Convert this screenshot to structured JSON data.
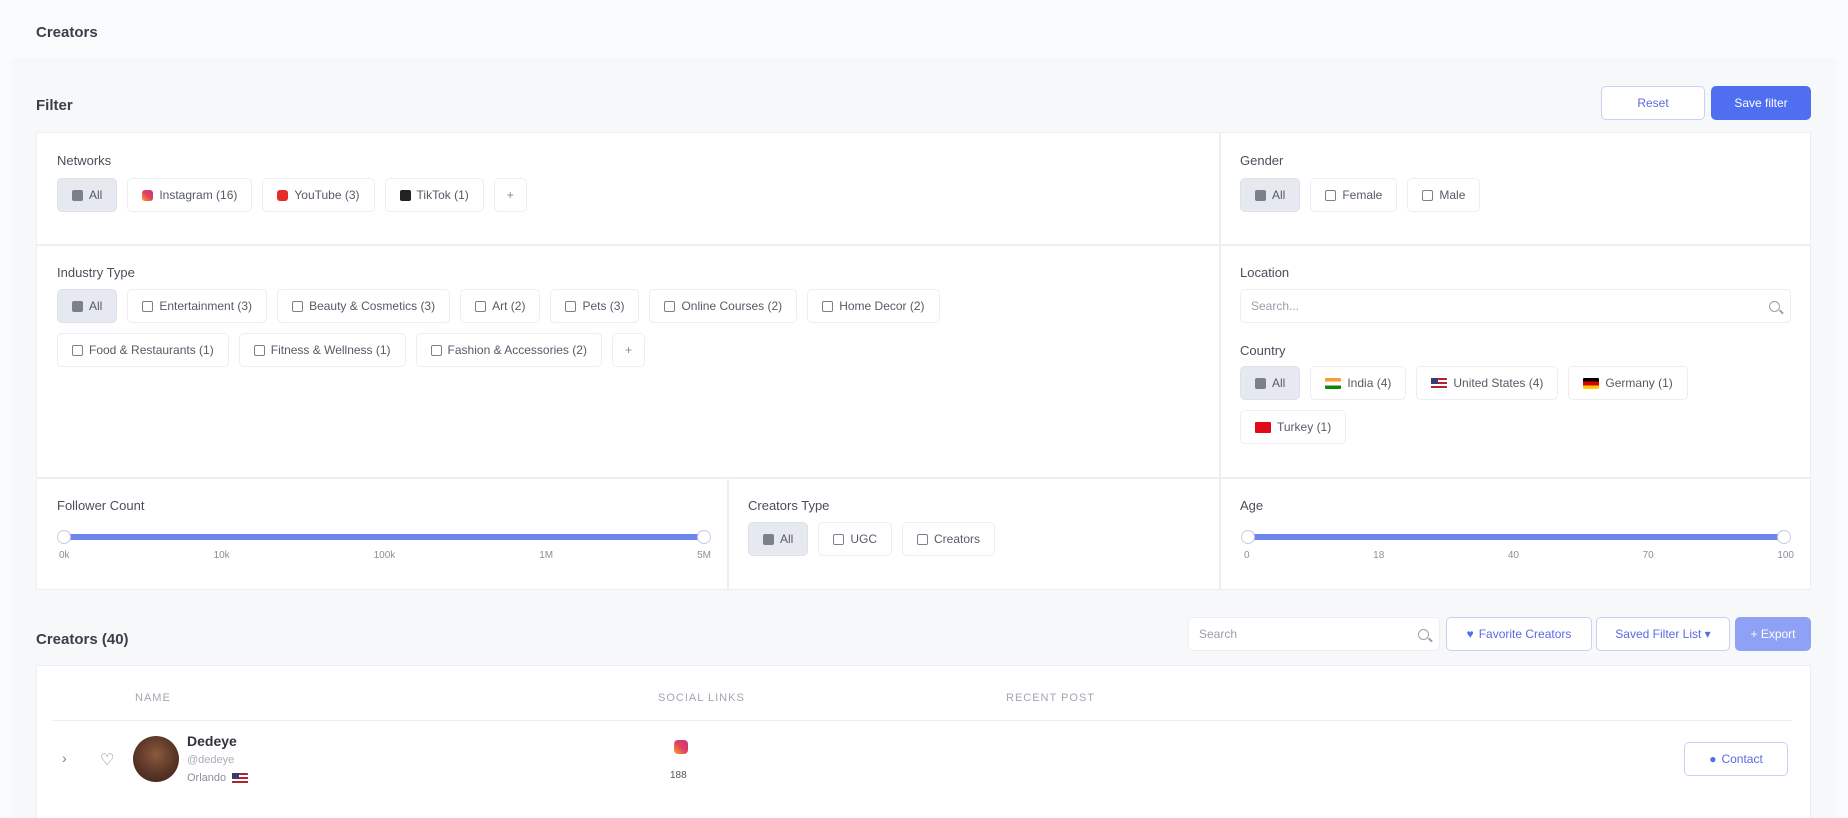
{
  "page": {
    "title": "Creators"
  },
  "filters": {
    "title": "Filter",
    "reset_label": "Reset",
    "save_label": "Save filter",
    "networks": {
      "label": "Networks",
      "items": [
        "All",
        "Instagram (16)",
        "YouTube (3)",
        "TikTok (1)"
      ],
      "more": "+"
    },
    "gender": {
      "label": "Gender",
      "items": [
        "All",
        "Female",
        "Male"
      ]
    },
    "industry": {
      "label": "Industry Type",
      "items": [
        "All",
        "Entertainment (3)",
        "Beauty & Cosmetics (3)",
        "Art (2)",
        "Pets (3)",
        "Online Courses (2)",
        "Home Decor (2)",
        "Food & Restaurants (1)",
        "Fitness & Wellness (1)",
        "Fashion & Accessories (2)"
      ],
      "more": "+"
    },
    "location": {
      "label": "Location",
      "placeholder": "Search..."
    },
    "country": {
      "label": "Country",
      "items": [
        "All",
        "India (4)",
        "United States (4)",
        "Germany (1)",
        "Turkey (1)"
      ]
    },
    "follower_count": {
      "label": "Follower Count",
      "ticks": [
        "0k",
        "10k",
        "100k",
        "1M",
        "5M"
      ],
      "range": [
        0,
        1
      ]
    },
    "creators_type": {
      "label": "Creators Type",
      "items": [
        "All",
        "UGC",
        "Creators"
      ]
    },
    "age": {
      "label": "Age",
      "ticks": [
        "0",
        "18",
        "40",
        "70",
        "100"
      ],
      "range": [
        0,
        1
      ]
    }
  },
  "list": {
    "title": "Creators (40)",
    "search_placeholder": "Search",
    "favorite_label": "Favorite Creators",
    "saved_filter_label": "Saved Filter List ▾",
    "action_label": "+ Export",
    "columns": [
      "NAME",
      "SOCIAL LINKS",
      "RECENT POST"
    ],
    "rows": [
      {
        "name": "Dedeye",
        "handle": "@dedeye",
        "location": "Orlando",
        "ig_count": "188",
        "contact_label": "Contact"
      }
    ]
  }
}
